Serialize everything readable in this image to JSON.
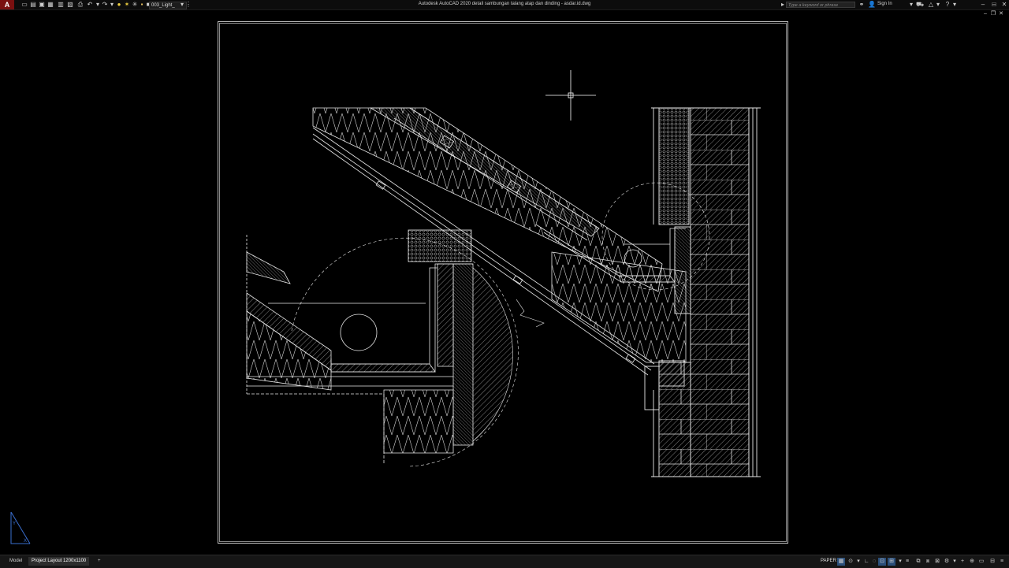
{
  "title_bar": {
    "app_logo": "A",
    "workspace": "003_Light_",
    "window_title": "Autodesk AutoCAD 2020   detail sambungan talang atap dan dinding - asdar.id.dwg",
    "search_placeholder": "Type a keyword or phrase",
    "sign_in": "Sign In",
    "icons": [
      "new-icon",
      "open-icon",
      "save-icon",
      "saveas-icon",
      "publish-icon",
      "plot-icon",
      "undo-icon",
      "redo-icon",
      "lightbulb-icon",
      "sun-icon",
      "freeze-icon",
      "lock-icon",
      "layer-icon"
    ]
  },
  "tabs": {
    "model": "Model",
    "layout": "Project Layout 1200x1100",
    "add": "+"
  },
  "status": {
    "paper": "PAPER"
  },
  "colors": {
    "background": "#000000",
    "drawing_line": "#ffffff",
    "accent": "#2b4f7a"
  }
}
